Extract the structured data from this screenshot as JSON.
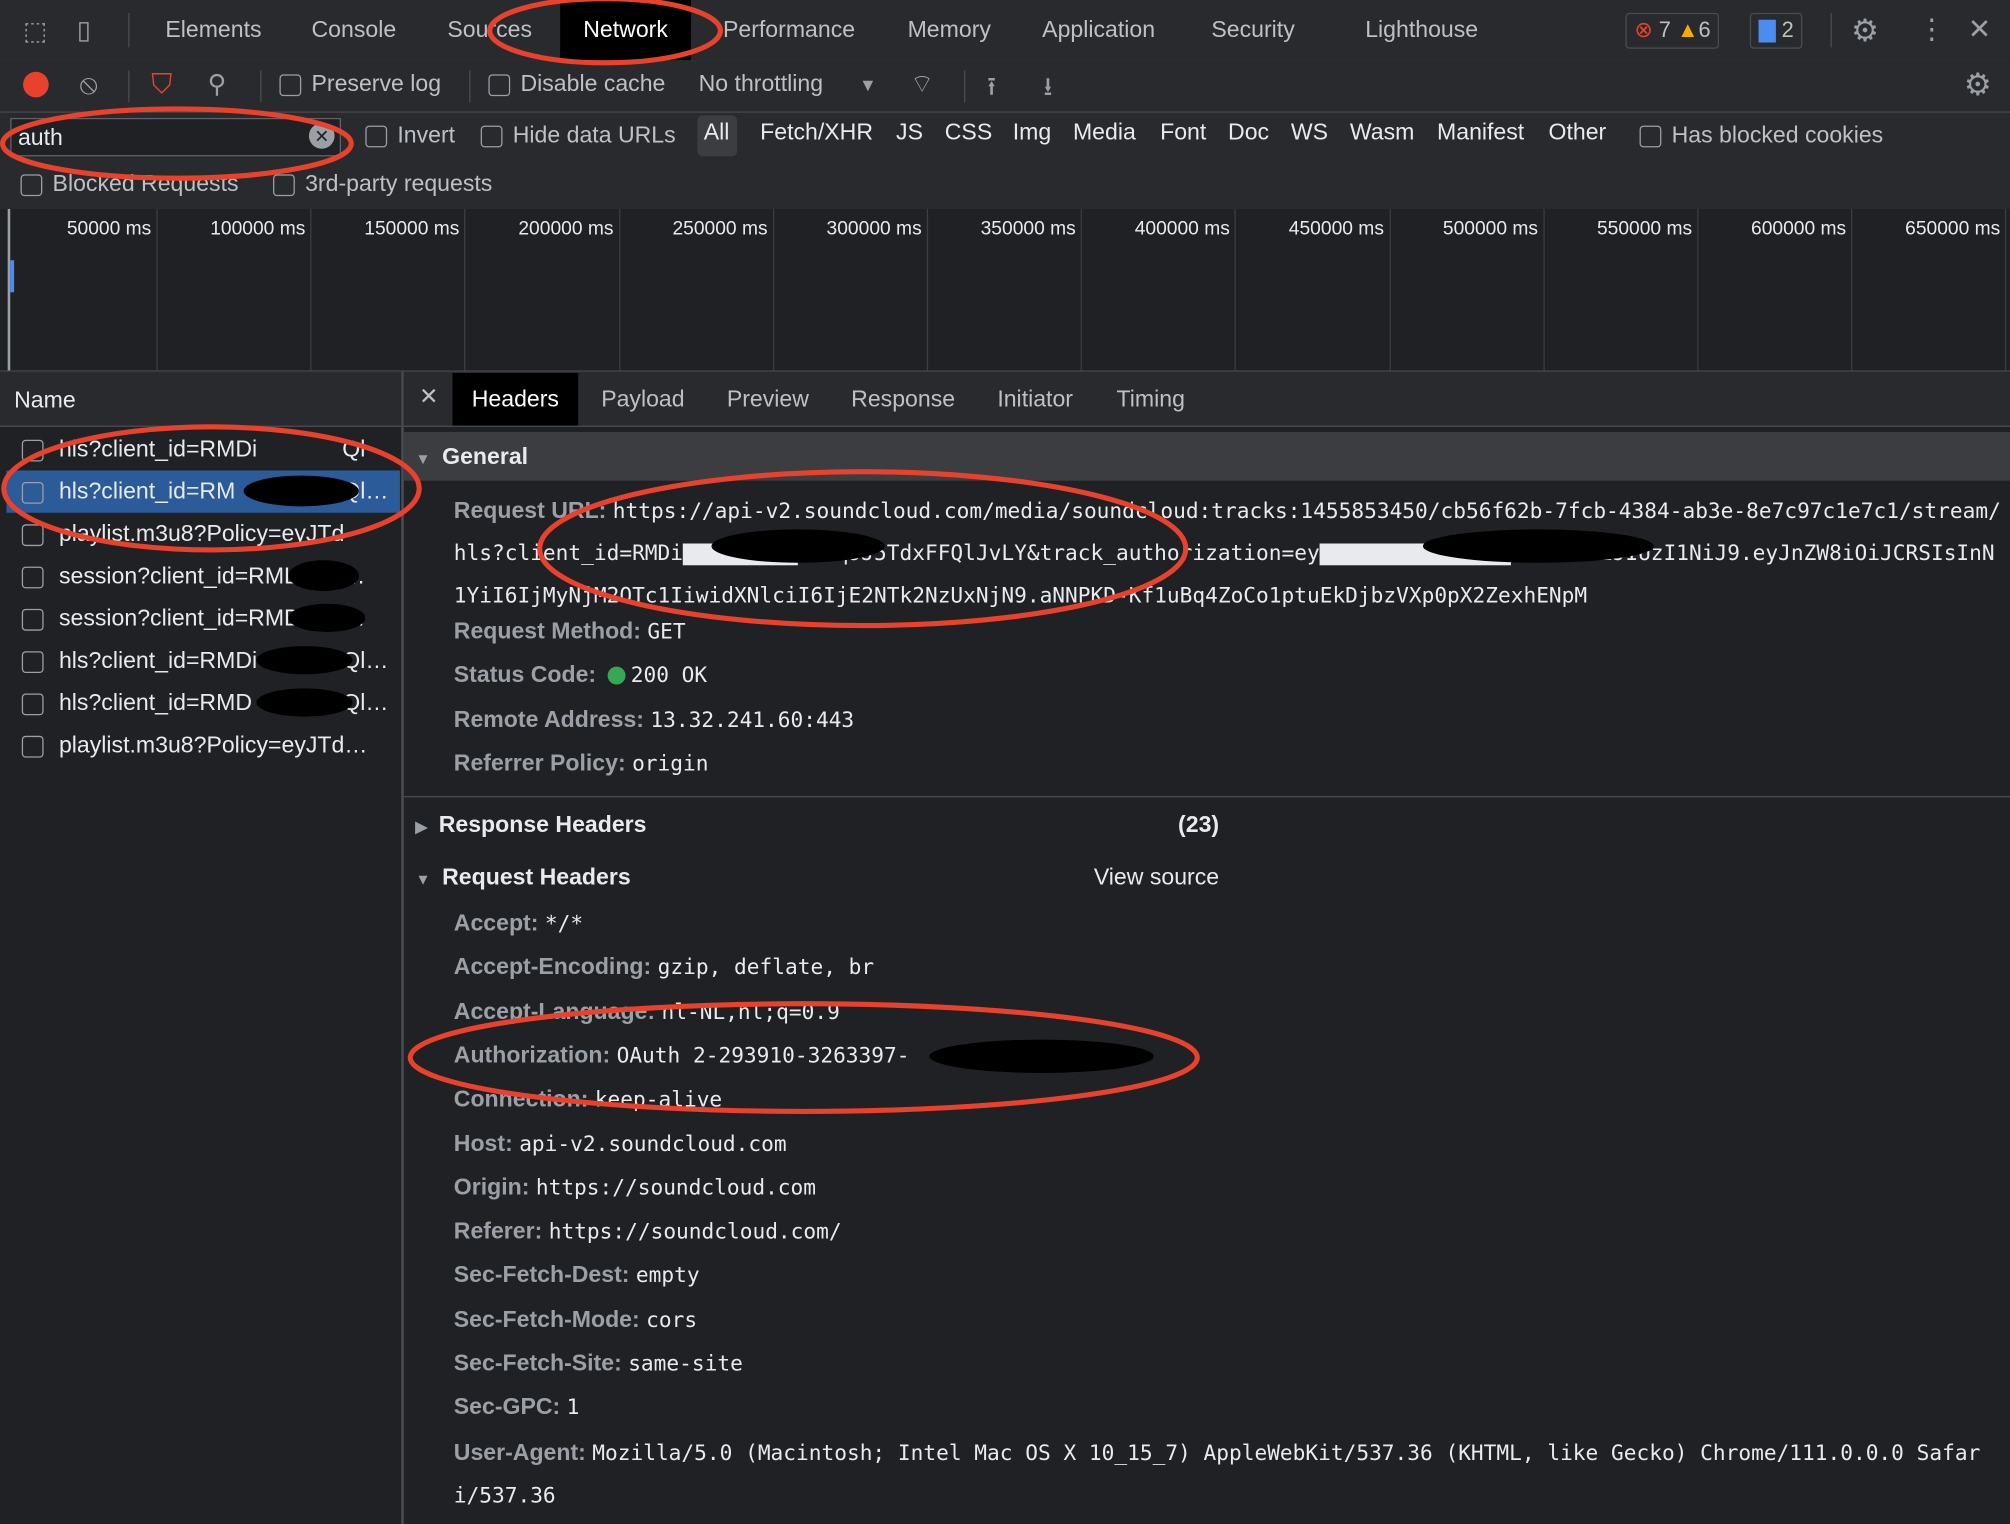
{
  "top_tabs": [
    "Elements",
    "Console",
    "Sources",
    "Network",
    "Performance",
    "Memory",
    "Application",
    "Security",
    "Lighthouse"
  ],
  "active_tab": "Network",
  "badges": {
    "errors": "7",
    "warnings": "6",
    "messages": "2"
  },
  "toolbar": {
    "preserve_log": "Preserve log",
    "disable_cache": "Disable cache",
    "throttling": "No throttling"
  },
  "filter": {
    "value": "auth",
    "invert": "Invert",
    "hide_data_urls": "Hide data URLs",
    "types": [
      "All",
      "Fetch/XHR",
      "JS",
      "CSS",
      "Img",
      "Media",
      "Font",
      "Doc",
      "WS",
      "Wasm",
      "Manifest",
      "Other"
    ],
    "selected_type": "All",
    "has_blocked_cookies": "Has blocked cookies",
    "blocked_requests": "Blocked Requests",
    "third_party": "3rd-party requests"
  },
  "timeline": {
    "ticks": [
      "50000 ms",
      "100000 ms",
      "150000 ms",
      "200000 ms",
      "250000 ms",
      "300000 ms",
      "350000 ms",
      "400000 ms",
      "450000 ms",
      "500000 ms",
      "550000 ms",
      "600000 ms",
      "650000 ms"
    ]
  },
  "requests": {
    "header": "Name",
    "rows": [
      "hls?client_id=RMDi",
      "hls?client_id=RM",
      "playlist.m3u8?Policy=eyJTd",
      "session?client_id=RML",
      "session?client_id=RMDi",
      "hls?client_id=RMDi",
      "hls?client_id=RMD",
      "playlist.m3u8?Policy=eyJTd…"
    ],
    "row_tails": [
      "Ql",
      "Ql…",
      "",
      "…",
      "…",
      "Ql…",
      "Ql…",
      ""
    ],
    "selected_index": 1
  },
  "details": {
    "tabs": [
      "Headers",
      "Payload",
      "Preview",
      "Response",
      "Initiator",
      "Timing"
    ],
    "active_tab": "Headers",
    "general": {
      "title": "General",
      "rows": [
        {
          "k": "Request URL:",
          "v": "https://api-v2.soundcloud.com/media/soundcloud:tracks:1455853450/cb56f62b-7fcb-4384-ab3e-8e7c97c1e7c1/stream/hls?client_id=RMDi▇▇▇▇▇▇▇▇▇T3xq9J5TdxFFQlJvLY&track_authorization=ey▇▇▇▇▇▇▇▇▇▇▇▇▇▇▇JhbGciOiJIUzI1NiJ9.eyJnZW8iOiJCRSIsInN1YiI6IjMyNjM2OTc1IiwidXNlciI6IjE2NTk2NzUxNjN9.aNNPKD-Kf1uBq4ZoCo1ptuEkDjbzVXp0pX2ZexhENpM"
        },
        {
          "k": "Request Method:",
          "v": "GET"
        },
        {
          "k": "Status Code:",
          "v": "200 OK"
        },
        {
          "k": "Remote Address:",
          "v": "13.32.241.60:443"
        },
        {
          "k": "Referrer Policy:",
          "v": "origin"
        }
      ]
    },
    "response_headers": {
      "title": "Response Headers",
      "count": "(23)"
    },
    "request_headers": {
      "title": "Request Headers",
      "view_source": "View source",
      "rows": [
        {
          "k": "Accept:",
          "v": "*/*"
        },
        {
          "k": "Accept-Encoding:",
          "v": "gzip, deflate, br"
        },
        {
          "k": "Accept-Language:",
          "v": "nl-NL,nl;q=0.9"
        },
        {
          "k": "Authorization:",
          "v": "OAuth 2-293910-3263397-"
        },
        {
          "k": "Connection:",
          "v": "keep-alive"
        },
        {
          "k": "Host:",
          "v": "api-v2.soundcloud.com"
        },
        {
          "k": "Origin:",
          "v": "https://soundcloud.com"
        },
        {
          "k": "Referer:",
          "v": "https://soundcloud.com/"
        },
        {
          "k": "Sec-Fetch-Dest:",
          "v": "empty"
        },
        {
          "k": "Sec-Fetch-Mode:",
          "v": "cors"
        },
        {
          "k": "Sec-Fetch-Site:",
          "v": "same-site"
        },
        {
          "k": "Sec-GPC:",
          "v": "1"
        },
        {
          "k": "User-Agent:",
          "v": "Mozilla/5.0 (Macintosh; Intel Mac OS X 10_15_7) AppleWebKit/537.36 (KHTML, like Gecko) Chrome/111.0.0.0 Safari/537.36"
        }
      ]
    }
  },
  "colors": {
    "annotation": "#e8412c",
    "selected_row": "#2b5b99",
    "status_ok": "#34a853",
    "record": "#e8412c"
  }
}
